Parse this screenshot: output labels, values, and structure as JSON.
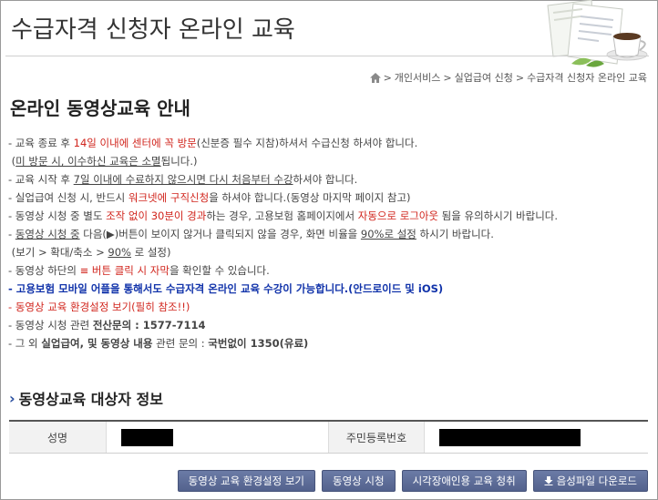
{
  "header": {
    "title": "수급자격 신청자 온라인 교육"
  },
  "breadcrumb": {
    "home_icon": "home-icon",
    "items": [
      "개인서비스",
      "실업급여 신청",
      "수급자격 신청자 온라인 교육"
    ],
    "separator": ">"
  },
  "main": {
    "title": "온라인 동영상교육 안내",
    "notes": {
      "n1a": "- 교육 종료 후 ",
      "n1b": "14일 이내에 센터에 꼭 방문",
      "n1c": "(신분증 필수 지참)하셔서 수급신청 하셔야 합니다.",
      "n2a": "(",
      "n2b": "미 방문 시, 이수하신 교육은 소멸",
      "n2c": "됩니다.)",
      "n3a": "- 교육 시작 후 ",
      "n3b": "7일 이내에 수료하지 않으시면 다시 처음부터 수강",
      "n3c": "하셔야 합니다.",
      "n4a": "- 실업급여 신청 시, 반드시 ",
      "n4b": "워크넷에 구직신청",
      "n4c": "을 하셔야 합니다.(동영상 마지막 페이지 참고)",
      "n5a": "- 동영상 시청 중 별도 ",
      "n5b": "조작 없이 30분이 경과",
      "n5c": "하는 경우, 고용보험 홈페이지에서 ",
      "n5d": "자동으로 로그아웃",
      "n5e": " 됨을 유의하시기 바랍니다.",
      "n6a": "- ",
      "n6b": "동영상 시청 중",
      "n6c": " 다음(▶)버튼이 보이지 않거나 클릭되지 않을 경우, 화면 비율을 ",
      "n6d": "90%로 설정",
      "n6e": " 하시기 바랍니다.",
      "n7a": "(보기 > 확대/축소 > ",
      "n7b": "90%",
      "n7c": " 로 설정)",
      "n8a": "- 동영상 하단의 ",
      "n8b": "≡ 버튼 클릭 시 자막",
      "n8c": "을 확인할 수 있습니다.",
      "n9": "- 고용보험 모바일 어플을 통해서도 수급자격 온라인 교육 수강이 가능합니다.(안드로이드 및 iOS)",
      "n10a": "- ",
      "n10b": "동영상 교육 환경설정 보기(필히 참조!!)",
      "n11a": "- 동영상 시청 관련 ",
      "n11b": "전산문의 : 1577-7114",
      "n12a": "- 그 외 ",
      "n12b": "실업급여, 및 동영상 내용",
      "n12c": " 관련 문의 : ",
      "n12d": "국번없이 1350(유료)"
    }
  },
  "target_info": {
    "title": "동영상교육 대상자 정보",
    "name_label": "성명",
    "id_label": "주민등록번호"
  },
  "buttons": {
    "env": "동영상 교육 환경설정 보기",
    "watch": "동영상 시청",
    "blind": "시각장애인용 교육 청취",
    "audio": "음성파일 다운로드"
  },
  "colors": {
    "accent_red": "#d1251d",
    "accent_blue": "#1133aa",
    "button_bg": "#5d6c98"
  }
}
